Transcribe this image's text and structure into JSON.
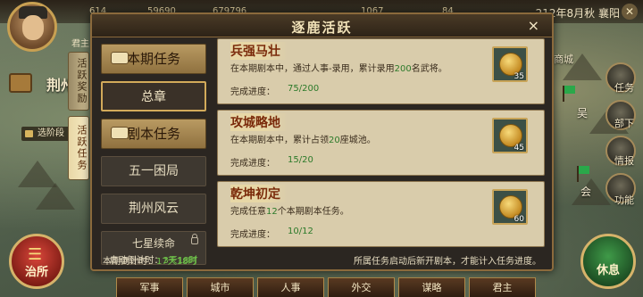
{
  "topbar": {
    "resources": [
      "614",
      "59690",
      "679796",
      "1067",
      "84"
    ],
    "date": "212年8月秋",
    "city": "襄阳"
  },
  "left_hud": {
    "lord_label": "君主",
    "city_name": "荆州",
    "select_rank": "选阶段",
    "govern_label": "治所"
  },
  "side_tabs": [
    {
      "label": "活跃奖励"
    },
    {
      "label": "活跃任务"
    }
  ],
  "dialog": {
    "title": "逐鹿活跃",
    "close": "×",
    "menu": {
      "current_tasks": "本期任务",
      "general_chapter": "总章",
      "script_tasks": "剧本任务",
      "script_1": "五一困局",
      "script_2": "荆州风云",
      "locked_name": "七星续命",
      "locked_countdown_label": "启动倒计时：",
      "locked_countdown_value": "3天18时"
    },
    "tasks": [
      {
        "title": "兵强马壮",
        "desc_pre": "在本期剧本中，通过人事-录用，累计录用",
        "desc_hl": "200",
        "desc_post": "名武将。",
        "progress_label": "完成进度：",
        "progress": "75/200",
        "reward_count": "35"
      },
      {
        "title": "攻城略地",
        "desc_pre": "在本期剧本中，累计占领",
        "desc_hl": "20",
        "desc_post": "座城池。",
        "progress_label": "完成进度：",
        "progress": "15/20",
        "reward_count": "45"
      },
      {
        "title": "乾坤初定",
        "desc_pre": "完成任意",
        "desc_hl": "12",
        "desc_post": "个本期剧本任务。",
        "progress_label": "完成进度：",
        "progress": "10/12",
        "reward_count": "60"
      }
    ],
    "footer": {
      "countdown_label": "本期倒计时：",
      "countdown_value": "17天18时",
      "note": "所属任务启动后新开剧本，才能计入任务进度。"
    }
  },
  "right_hud": {
    "shop": "商城",
    "task": "任务",
    "staff": "部下",
    "intel": "情报",
    "function": "功能",
    "wu": "吴",
    "meeting": "会",
    "rest": "休息"
  },
  "bottombar": [
    "军事",
    "城市",
    "人事",
    "外交",
    "谋略",
    "君主"
  ]
}
